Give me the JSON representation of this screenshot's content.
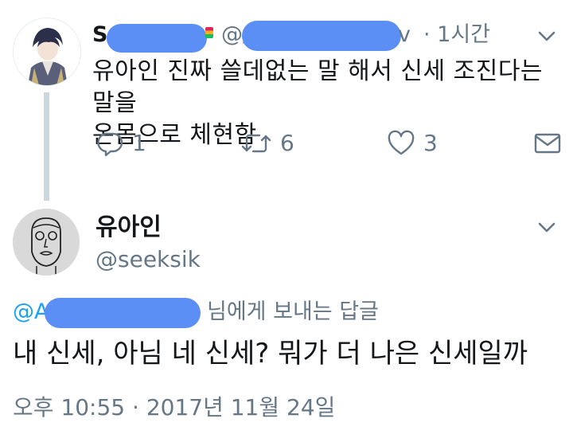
{
  "tweet1": {
    "name_initial": "S",
    "handle_prefix": "@/",
    "handle_suffix": "v",
    "time": "· 1시간",
    "text_lines": [
      "유아인 진짜 쓸데없는 말 해서 신세 조진다는 말을",
      "온몸으로 체현함"
    ],
    "actions": {
      "reply_count": "1",
      "retweet_count": "6",
      "like_count": "3"
    }
  },
  "tweet2": {
    "name": "유아인",
    "handle": "@seeksik",
    "reply_prefix": "@A",
    "reply_to_text": "님에게 보내는 답글",
    "text": "내 신세, 아님 네 신세? 뭐가 더 나은 신세일까",
    "timestamp": "오후 10:55 · 2017년 11월 24일"
  },
  "colors": {
    "redaction": "#5b8ff6",
    "secondary_text": "#657786",
    "primary_text": "#14171a",
    "link": "#1da1f2",
    "thread_line": "#ccd6dd"
  },
  "icons": [
    "chevron-down-icon",
    "reply-icon",
    "retweet-icon",
    "heart-icon",
    "message-icon"
  ]
}
